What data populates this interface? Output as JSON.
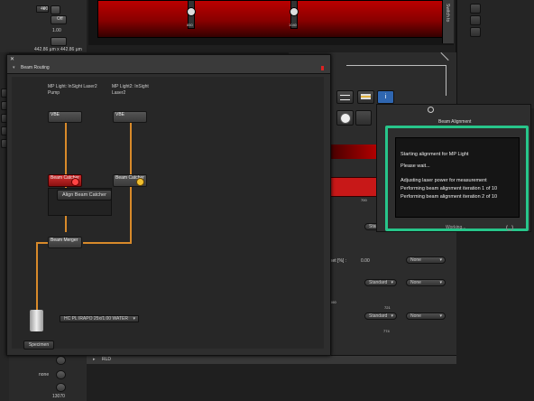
{
  "top_left": {
    "power_value": "400",
    "off_label": "Off",
    "gain_value": "1.00",
    "size_text": "442.86 µm x 442.86 µm"
  },
  "left_strip": {
    "none_label": "none",
    "number": "13070"
  },
  "top_sliders": {
    "left_value": "850",
    "right_value": "1040",
    "side_label": "Switch to"
  },
  "beam_routing": {
    "title": "Beam Routing",
    "laser1_label": "MP Light: InSight Laser2 Pump",
    "laser2_label": "MP Light2: InSight Laser2",
    "vbe1": "VBE",
    "vbe2": "VBE",
    "catcher1": "Beam Catcher",
    "catcher2": "Beam Catcher",
    "align_button": "Align Beam Catcher",
    "merger": "Beam Merger",
    "objective": "HC PL IRAPO   25x/1.00 WATER",
    "specimen": "Specimen"
  },
  "right_panel": {
    "scale_value": "700",
    "standard_1": "Standard",
    "offset_label": "set [%] :",
    "offset_value": "0.00",
    "none_1": "None",
    "standard_2": "Standard",
    "none_2": "None",
    "standard_3": "Standard",
    "none_3": "None",
    "value_721": "721",
    "value_660": "660",
    "value_774": "774",
    "rld_label": "RLD"
  },
  "beam_alignment": {
    "title": "Beam Alignment",
    "lines": [
      "Starting alignment for MP Light",
      "Please wait...",
      "Adjusting laser power for measurement",
      "Performing beam alignment iteration 1 of 10",
      "Performing beam alignment iteration 2 of 10"
    ],
    "status": "Working..."
  }
}
